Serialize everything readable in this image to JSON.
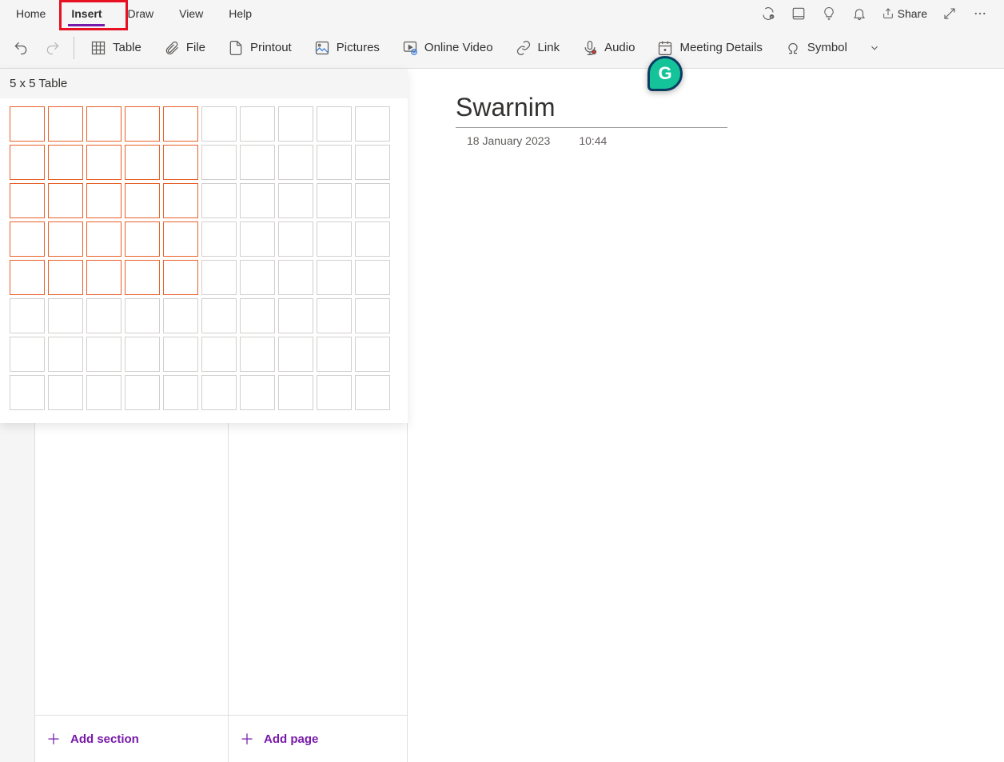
{
  "menubar": {
    "items": [
      "Home",
      "Insert",
      "Draw",
      "View",
      "Help"
    ],
    "active_index": 1
  },
  "header_actions": {
    "share_label": "Share"
  },
  "ribbon": {
    "table": "Table",
    "file": "File",
    "printout": "Printout",
    "pictures": "Pictures",
    "online_video": "Online Video",
    "link": "Link",
    "audio": "Audio",
    "meeting_details": "Meeting Details",
    "symbol": "Symbol"
  },
  "table_picker": {
    "label": "5 x 5 Table",
    "rows": 8,
    "cols": 10,
    "sel_rows": 5,
    "sel_cols": 5
  },
  "page": {
    "title": "Swarnim",
    "date": "18 January 2023",
    "time": "10:44"
  },
  "sidebar": {
    "add_section": "Add section",
    "add_page": "Add page"
  }
}
